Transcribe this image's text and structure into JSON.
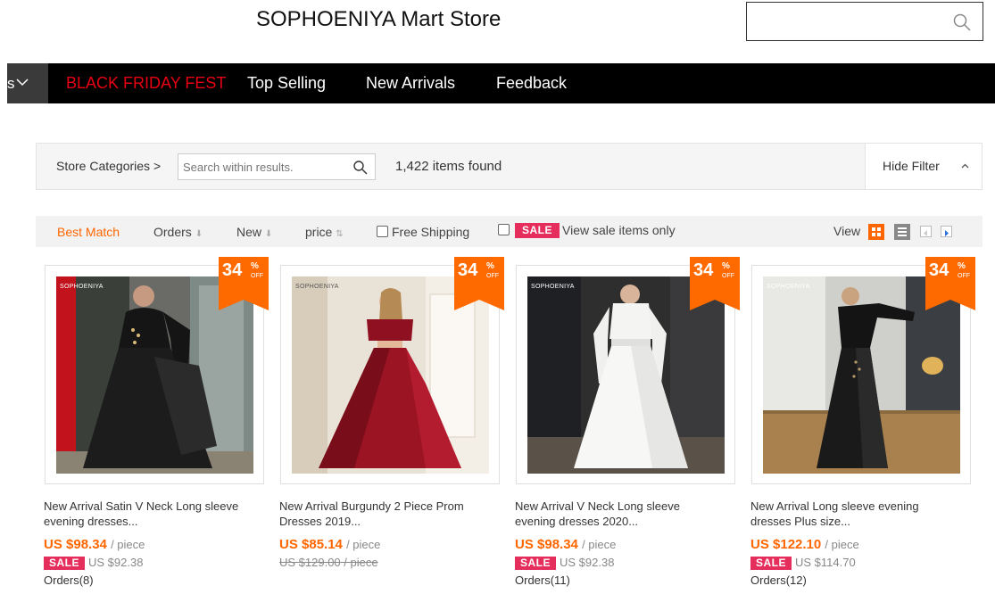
{
  "header": {
    "store_title": "SOPHOENIYA Mart Store",
    "search_placeholder": ""
  },
  "nav": {
    "category_stub": "s",
    "items": [
      {
        "label": "BLACK FRIDAY FEST",
        "color": "#e60012"
      },
      {
        "label": "Top Selling"
      },
      {
        "label": "New Arrivals"
      },
      {
        "label": "Feedback"
      }
    ]
  },
  "filter": {
    "categories_label": "Store Categories >",
    "search_placeholder": "Search within results.",
    "items_found": "1,422 items found",
    "hide_filter": "Hide Filter"
  },
  "sort": {
    "best_match": "Best Match",
    "orders": "Orders",
    "new": "New",
    "price": "price",
    "free_shipping": "Free Shipping",
    "sale_badge": "SALE",
    "sale_only": "View sale items only",
    "view_label": "View"
  },
  "colors": {
    "accent": "#ff6600",
    "sale": "#e62e5c",
    "nav_bg": "#000000",
    "black_friday": "#e60012"
  },
  "discount": {
    "pct_sign": "%",
    "off": "OFF"
  },
  "products": [
    {
      "brand": "SOPHOENIYA",
      "discount": "34",
      "title_line1": "New Arrival Satin V Neck Long sleeve",
      "title_line2": "evening dresses...",
      "price": "US $98.34",
      "unit": "/ piece",
      "sale_badge": "SALE",
      "sale_price": "US $92.38",
      "orders": "Orders(8)"
    },
    {
      "brand": "SOPHOENIYA",
      "discount": "34",
      "title_line1": "New Arrival Burgundy 2 Piece Prom",
      "title_line2": "Dresses 2019...",
      "price": "US $85.14",
      "unit": "/ piece",
      "old_price": "US $129.00 / piece"
    },
    {
      "brand": "SOPHOENIYA",
      "discount": "34",
      "title_line1": "New Arrival V Neck Long sleeve",
      "title_line2": "evening dresses 2020...",
      "price": "US $98.34",
      "unit": "/ piece",
      "sale_badge": "SALE",
      "sale_price": "US $92.38",
      "orders": "Orders(11)"
    },
    {
      "brand": "SOPHOENIYA",
      "discount": "34",
      "title_line1": "New Arrival Long sleeve evening",
      "title_line2": "dresses Plus size...",
      "price": "US $122.10",
      "unit": "/ piece",
      "sale_badge": "SALE",
      "sale_price": "US $114.70",
      "orders": "Orders(12)"
    }
  ]
}
